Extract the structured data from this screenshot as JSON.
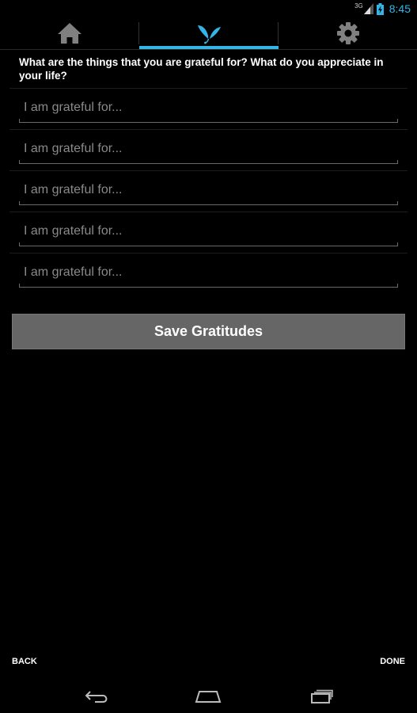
{
  "status_bar": {
    "network": "3G",
    "clock": "8:45"
  },
  "tabs": [
    {
      "name": "home",
      "icon": "home-icon",
      "selected": false
    },
    {
      "name": "gratitude",
      "icon": "butterfly-icon",
      "selected": true
    },
    {
      "name": "settings",
      "icon": "gear-icon",
      "selected": false
    }
  ],
  "colors": {
    "accent": "#33b5e5",
    "background": "#000000",
    "button": "#666666"
  },
  "prompt": "What are the things that you are grateful for? What do you appreciate in your life?",
  "entries": [
    {
      "value": "",
      "placeholder": "I am grateful for..."
    },
    {
      "value": "",
      "placeholder": "I am grateful for..."
    },
    {
      "value": "",
      "placeholder": "I am grateful for..."
    },
    {
      "value": "",
      "placeholder": "I am grateful for..."
    },
    {
      "value": "",
      "placeholder": "I am grateful for..."
    }
  ],
  "save_button": "Save Gratitudes",
  "bottom_actions": {
    "back": "BACK",
    "done": "DONE"
  },
  "nav_bar": [
    "back-icon",
    "home-outline-icon",
    "recent-apps-icon"
  ]
}
